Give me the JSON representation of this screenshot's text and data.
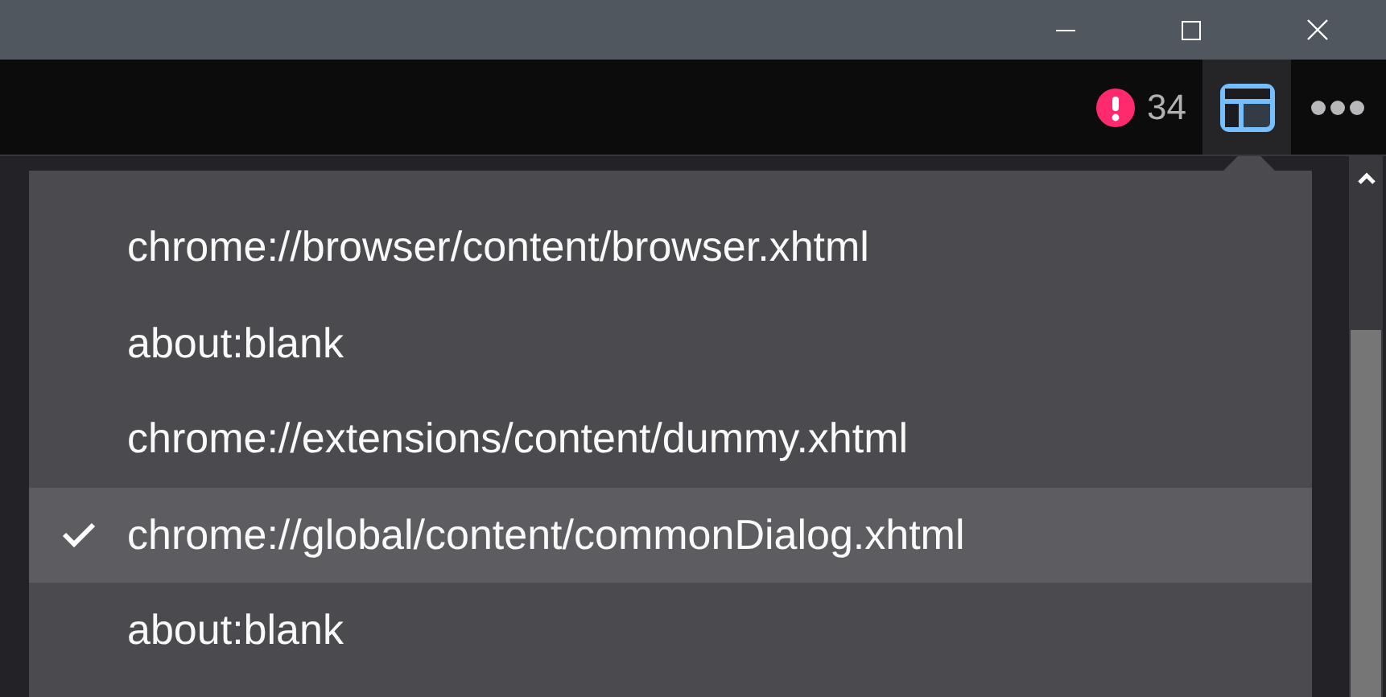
{
  "toolbar": {
    "error_count": "34",
    "frames_button": {
      "selected": true
    }
  },
  "frames_menu": {
    "items": [
      {
        "label": "chrome://browser/content/browser.xhtml",
        "checked": false
      },
      {
        "label": "about:blank",
        "checked": false
      },
      {
        "label": "chrome://extensions/content/dummy.xhtml",
        "checked": false
      },
      {
        "label": "chrome://global/content/commonDialog.xhtml",
        "checked": true
      },
      {
        "label": "about:blank",
        "checked": false
      }
    ]
  }
}
